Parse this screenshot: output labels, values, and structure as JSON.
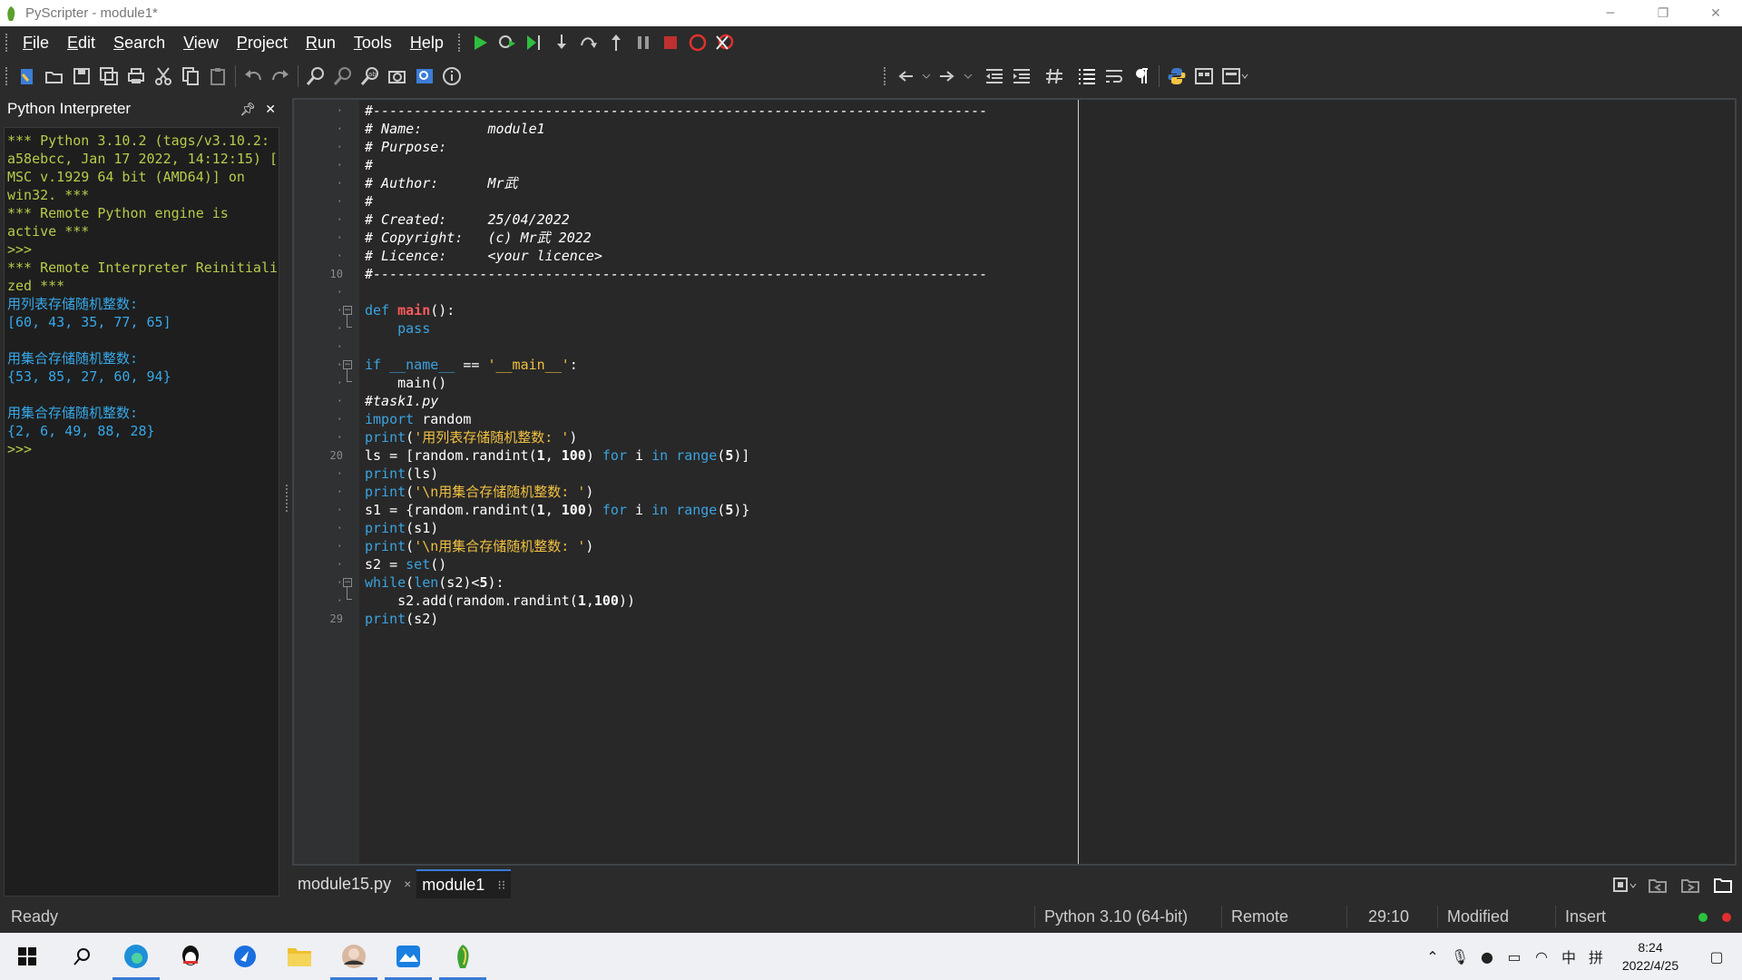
{
  "window": {
    "title": "PyScripter - module1*"
  },
  "menu": [
    "File",
    "Edit",
    "Search",
    "View",
    "Project",
    "Run",
    "Tools",
    "Help"
  ],
  "menu_underline": [
    "F",
    "E",
    "S",
    "V",
    "P",
    "R",
    "T",
    "H"
  ],
  "interpreter": {
    "title": "Python Interpreter",
    "lines": [
      {
        "t": "*** Python 3.10.2 (tags/v3.10.2:",
        "c": "g"
      },
      {
        "t": "a58ebcc, Jan 17 2022, 14:12:15) [",
        "c": "g"
      },
      {
        "t": "MSC v.1929 64 bit (AMD64)] on",
        "c": "g"
      },
      {
        "t": "win32. ***",
        "c": "g"
      },
      {
        "t": "*** Remote Python engine is",
        "c": "g"
      },
      {
        "t": "active ***",
        "c": "g"
      },
      {
        "t": ">>>",
        "c": "g"
      },
      {
        "t": "*** Remote Interpreter Reinitiali",
        "c": "g"
      },
      {
        "t": "zed ***",
        "c": "g"
      },
      {
        "t": "用列表存储随机整数:",
        "c": "c"
      },
      {
        "t": "[60, 43, 35, 77, 65]",
        "c": "c"
      },
      {
        "t": "",
        "c": "c"
      },
      {
        "t": "用集合存储随机整数:",
        "c": "c"
      },
      {
        "t": "{53, 85, 27, 60, 94}",
        "c": "c"
      },
      {
        "t": "",
        "c": "c"
      },
      {
        "t": "用集合存储随机整数:",
        "c": "c"
      },
      {
        "t": "{2, 6, 49, 88, 28}",
        "c": "c"
      },
      {
        "t": ">>>",
        "c": "g"
      }
    ]
  },
  "editor": {
    "line_numbers": [
      "·",
      "·",
      "·",
      "·",
      "·",
      "·",
      "·",
      "·",
      "·",
      "10",
      "·",
      "·",
      "·",
      "·",
      "·",
      "·",
      "·",
      "·",
      "·",
      "20",
      "·",
      "·",
      "·",
      "·",
      "·",
      "·",
      "·",
      "·",
      "29"
    ],
    "code": [
      "#---------------------------------------------------------------------------",
      "# Name:        module1",
      "# Purpose:",
      "#",
      "# Author:      Mr武",
      "#",
      "# Created:     25/04/2022",
      "# Copyright:   (c) Mr武 2022",
      "# Licence:     <your licence>",
      "#---------------------------------------------------------------------------",
      "",
      "def main():",
      "    pass",
      "",
      "if __name__ == '__main__':",
      "    main()",
      "#task1.py",
      "import random",
      "print('用列表存储随机整数: ')",
      "ls = [random.randint(1, 100) for i in range(5)]",
      "print(ls)",
      "print('\\n用集合存储随机整数: ')",
      "s1 = {random.randint(1, 100) for i in range(5)}",
      "print(s1)",
      "print('\\n用集合存储随机整数: ')",
      "s2 = set()",
      "while(len(s2)<5):",
      "    s2.add(random.randint(1,100))",
      "print(s2)"
    ]
  },
  "tabs": [
    {
      "label": "module15.py",
      "close": "×"
    },
    {
      "label": "module1",
      "close": "⁝⁝"
    }
  ],
  "status": {
    "ready": "Ready",
    "python": "Python 3.10 (64-bit)",
    "mode": "Remote",
    "position": "29:10",
    "modified": "Modified",
    "insert": "Insert"
  },
  "taskbar": {
    "time": "8:24",
    "date": "2022/4/25",
    "ime1": "中",
    "ime2": "拼"
  }
}
